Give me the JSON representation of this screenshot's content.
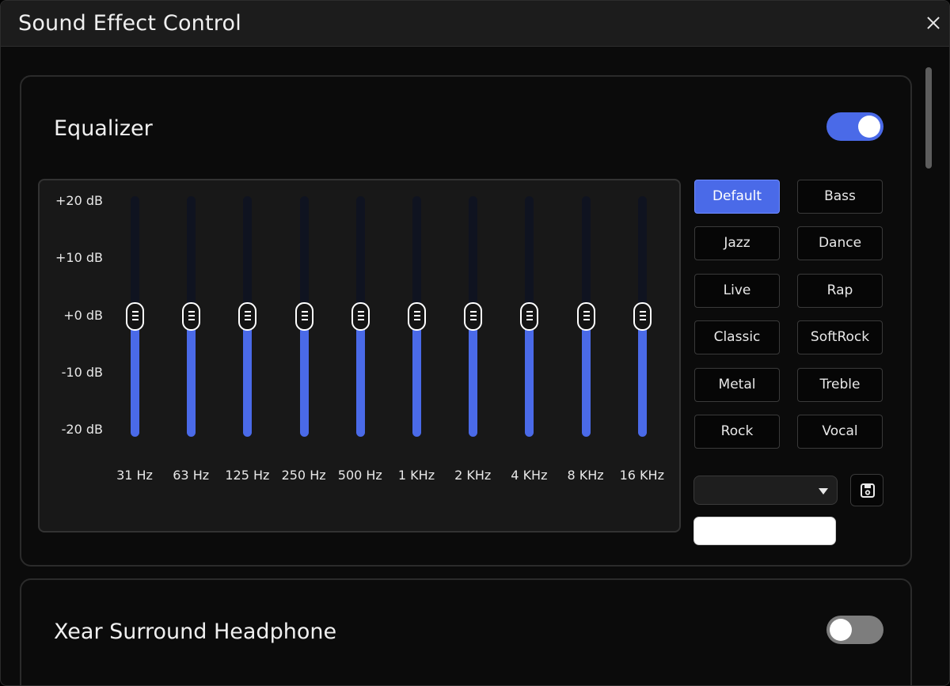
{
  "window": {
    "title": "Sound Effect Control",
    "close_label": "✕"
  },
  "equalizer": {
    "title": "Equalizer",
    "enabled": true,
    "db_labels": [
      "+20 dB",
      "+10 dB",
      "+0 dB",
      "-10 dB",
      "-20 dB"
    ],
    "db_range": [
      -20,
      20
    ],
    "bands": [
      {
        "freq": "31 Hz",
        "gain_db": 0
      },
      {
        "freq": "63 Hz",
        "gain_db": 0
      },
      {
        "freq": "125 Hz",
        "gain_db": 0
      },
      {
        "freq": "250 Hz",
        "gain_db": 0
      },
      {
        "freq": "500 Hz",
        "gain_db": 0
      },
      {
        "freq": "1 KHz",
        "gain_db": 0
      },
      {
        "freq": "2 KHz",
        "gain_db": 0
      },
      {
        "freq": "4 KHz",
        "gain_db": 0
      },
      {
        "freq": "8 KHz",
        "gain_db": 0
      },
      {
        "freq": "16 KHz",
        "gain_db": 0
      }
    ],
    "presets": [
      "Default",
      "Bass",
      "Jazz",
      "Dance",
      "Live",
      "Rap",
      "Classic",
      "SoftRock",
      "Metal",
      "Treble",
      "Rock",
      "Vocal"
    ],
    "active_preset": "Default",
    "custom_preset_selected": "",
    "custom_preset_name": "",
    "save_icon": "save-icon"
  },
  "xear": {
    "title": "Xear Surround Headphone",
    "enabled": false
  },
  "colors": {
    "accent": "#4a6ae8",
    "toggle_off": "#7d7d7d",
    "background": "#0b0b0b"
  }
}
